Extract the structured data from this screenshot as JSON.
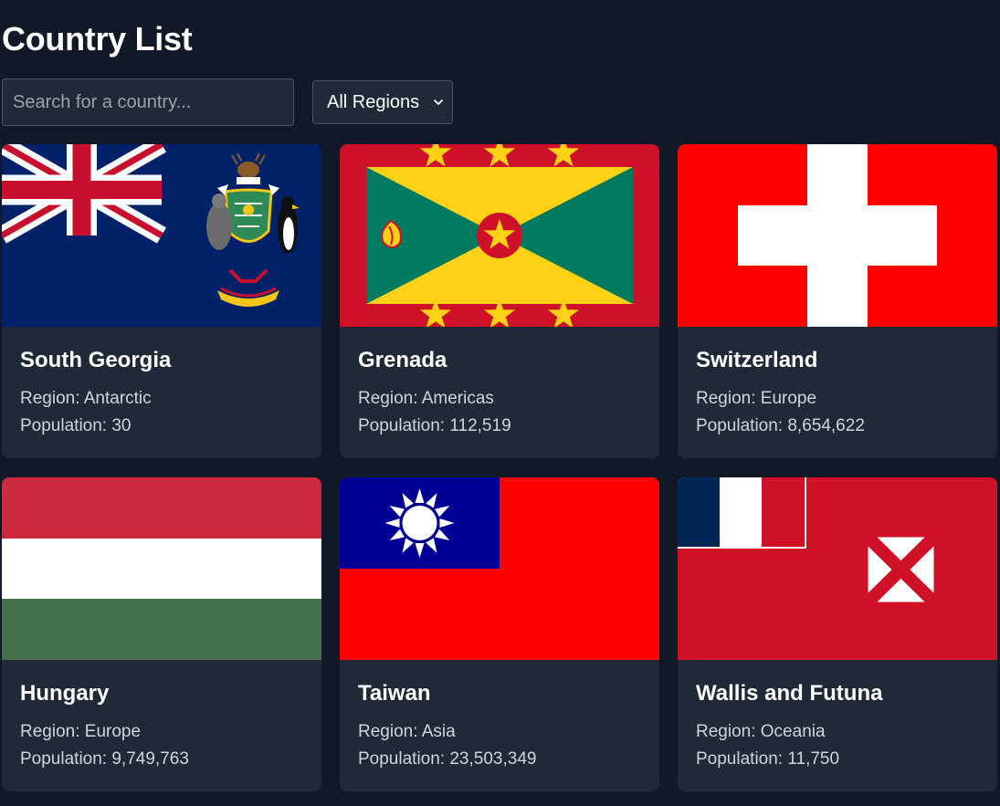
{
  "page": {
    "title": "Country List"
  },
  "search": {
    "placeholder": "Search for a country...",
    "value": ""
  },
  "region_filter": {
    "selected": "All Regions"
  },
  "labels": {
    "region": "Region: ",
    "population": "Population: "
  },
  "countries": [
    {
      "name": "South Georgia",
      "region": "Antarctic",
      "population": "30",
      "flag_icon": "south-georgia-flag-icon"
    },
    {
      "name": "Grenada",
      "region": "Americas",
      "population": "112,519",
      "flag_icon": "grenada-flag-icon"
    },
    {
      "name": "Switzerland",
      "region": "Europe",
      "population": "8,654,622",
      "flag_icon": "switzerland-flag-icon"
    },
    {
      "name": "Hungary",
      "region": "Europe",
      "population": "9,749,763",
      "flag_icon": "hungary-flag-icon"
    },
    {
      "name": "Taiwan",
      "region": "Asia",
      "population": "23,503,349",
      "flag_icon": "taiwan-flag-icon"
    },
    {
      "name": "Wallis and Futuna",
      "region": "Oceania",
      "population": "11,750",
      "flag_icon": "wallis-futuna-flag-icon"
    }
  ],
  "colors": {
    "background": "#111827",
    "card": "#1f2937",
    "border": "#4b5563",
    "muted_text": "#d1d5db"
  }
}
